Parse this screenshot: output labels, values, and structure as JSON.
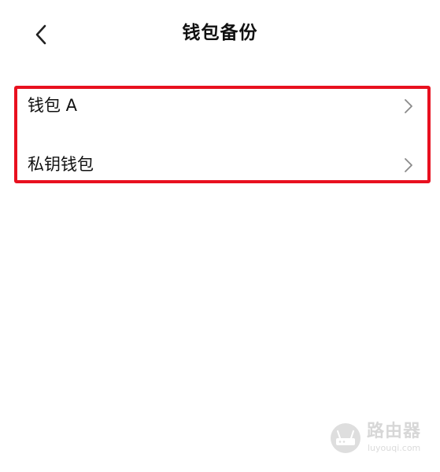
{
  "header": {
    "title": "钱包备份",
    "back_icon": "chevron-left-icon"
  },
  "list": {
    "items": [
      {
        "label": "钱包 A",
        "icon": "chevron-right-icon"
      },
      {
        "label": "私钥钱包",
        "icon": "chevron-right-icon"
      }
    ]
  },
  "highlight": {
    "color": "#e8101f"
  },
  "watermark": {
    "brand": "路由器",
    "domain": "luyouqi.com"
  }
}
